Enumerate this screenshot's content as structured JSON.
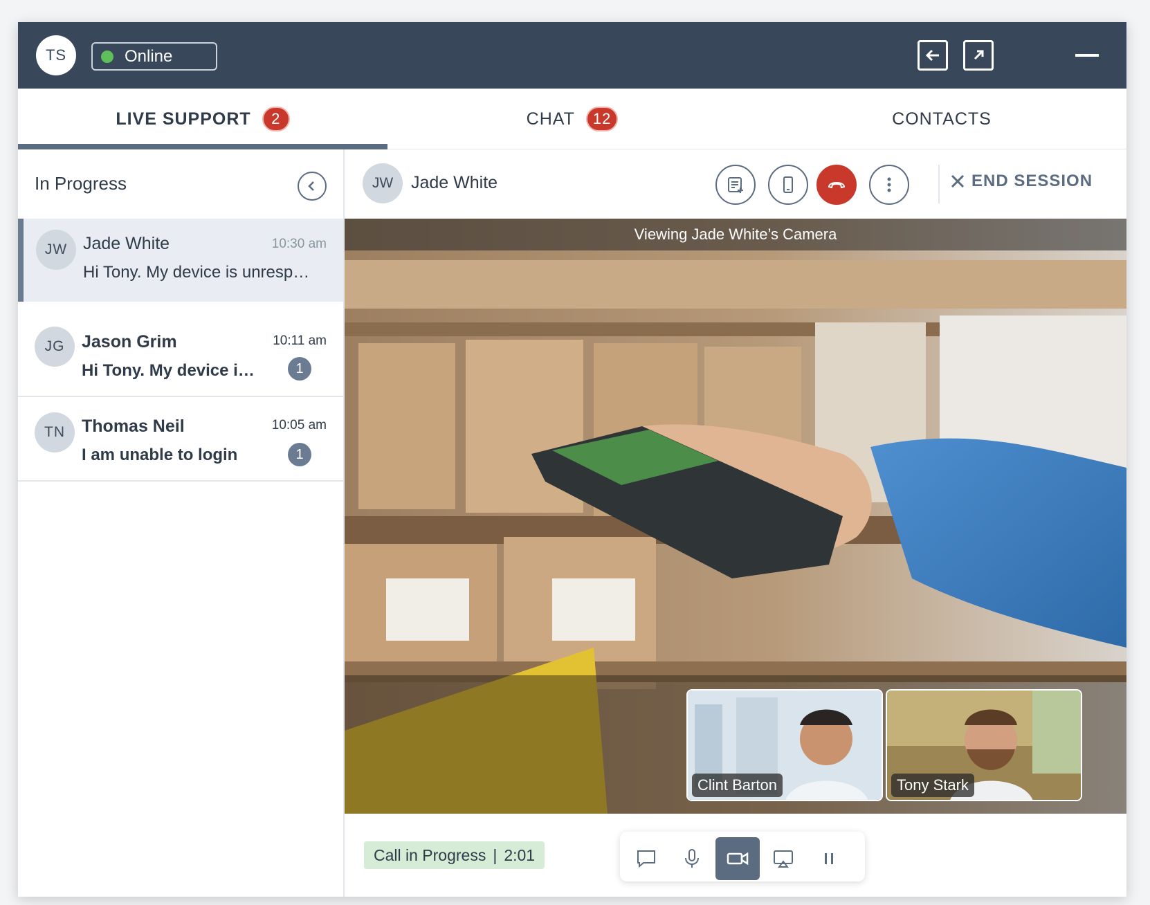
{
  "topbar": {
    "user_initials": "TS",
    "status_label": "Online",
    "status_color": "#5fbf5a",
    "icons": [
      "back-panel-icon",
      "popout-icon",
      "minimize-icon"
    ]
  },
  "tabs": [
    {
      "label": "LIVE SUPPORT",
      "badge": "2"
    },
    {
      "label": "CHAT",
      "badge": "12"
    },
    {
      "label": "CONTACTS"
    }
  ],
  "left_panel": {
    "title": "In Progress",
    "conversations": [
      {
        "initials": "JW",
        "name": "Jade White",
        "time": "10:30 am",
        "message": "Hi Tony. My device is unresponsive",
        "unread": ""
      },
      {
        "initials": "JG",
        "name": "Jason Grim",
        "time": "10:11 am",
        "message": "Hi Tony. My device is not working",
        "unread": "1"
      },
      {
        "initials": "TN",
        "name": "Thomas Neil",
        "time": "10:05 am",
        "message": "I am unable to login",
        "unread": "1"
      }
    ]
  },
  "session": {
    "initials": "JW",
    "name": "Jade White",
    "end_label": "END SESSION",
    "toolbar_icons": [
      "notes-add-icon",
      "device-icon",
      "hang-up-icon",
      "more-vertical-icon"
    ],
    "hang_color": "#c8392b"
  },
  "video": {
    "caption": "Viewing Jade White’s Camera",
    "participants": [
      "Clint Barton",
      "Tony Stark"
    ]
  },
  "bottom": {
    "status_label": "Call in Progress",
    "timer": "2:01",
    "controls": [
      "chat-icon",
      "microphone-icon",
      "video-camera-icon",
      "screen-share-icon",
      "pause-icon"
    ]
  }
}
